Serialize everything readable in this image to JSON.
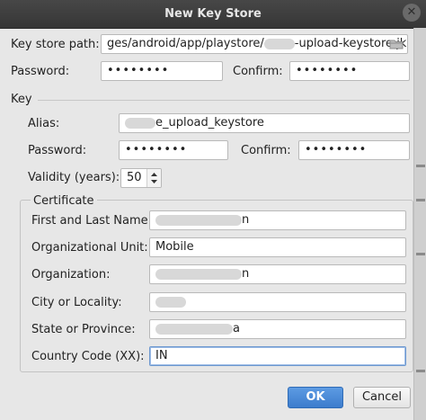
{
  "window": {
    "title": "New Key Store",
    "close_glyph": "✕"
  },
  "keystore": {
    "path_label": "Key store path:",
    "path_prefix": "ges/android/app/playstore/",
    "path_suffix": "-upload-keystore.jks",
    "password_label": "Password:",
    "password_value": "••••••••",
    "confirm_label": "Confirm:",
    "confirm_value": "••••••••"
  },
  "key": {
    "section_label": "Key",
    "alias_label": "Alias:",
    "alias_value": "e_upload_keystore",
    "password_label": "Password:",
    "password_value": "••••••••",
    "confirm_label": "Confirm:",
    "confirm_value": "••••••••",
    "validity_label": "Validity (years):",
    "validity_value": "50"
  },
  "certificate": {
    "section_label": "Certificate",
    "first_last_label": "First and Last Name:",
    "first_last_value_suffix": "n",
    "org_unit_label": "Organizational Unit:",
    "org_unit_value": "Mobile",
    "organization_label": "Organization:",
    "organization_value_suffix": "n",
    "city_label": "City or Locality:",
    "city_value": "",
    "state_label": "State or Province:",
    "state_value_suffix": "a",
    "country_label": "Country Code (XX):",
    "country_value": "IN"
  },
  "buttons": {
    "ok": "OK",
    "cancel": "Cancel"
  },
  "icons": {
    "folder": "folder-icon",
    "spinner": "spinner-arrows-icon",
    "close": "close-icon"
  }
}
